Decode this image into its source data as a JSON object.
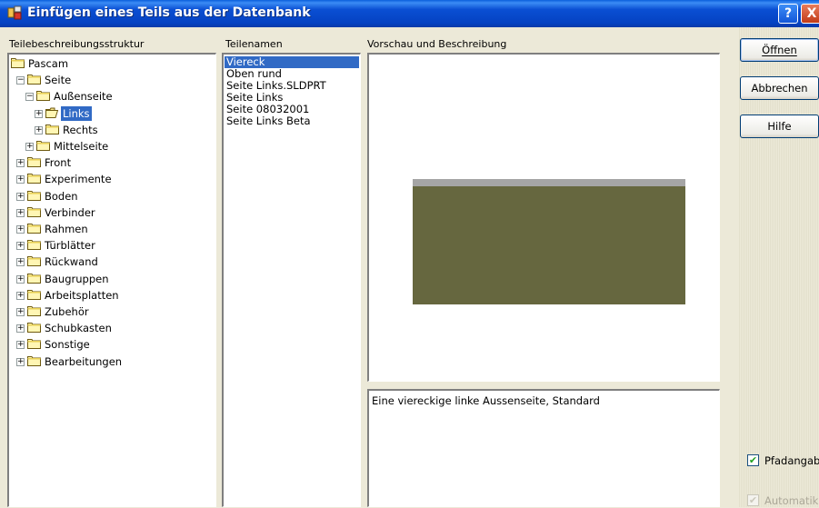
{
  "window": {
    "title": "Einfügen eines Teils aus der Datenbank",
    "help_label": "?",
    "close_label": "X"
  },
  "labels": {
    "tree": "Teilebeschreibungsstruktur",
    "parts": "Teilenamen",
    "preview": "Vorschau und Beschreibung"
  },
  "tree": {
    "items": [
      {
        "label": "Pascam",
        "expander": "",
        "selected": false
      },
      {
        "label": "Seite",
        "expander": "−",
        "selected": false
      },
      {
        "label": "Außenseite",
        "expander": "−",
        "selected": false
      },
      {
        "label": "Links",
        "expander": "+",
        "selected": true
      },
      {
        "label": "Rechts",
        "expander": "+",
        "selected": false
      },
      {
        "label": "Mittelseite",
        "expander": "+",
        "selected": false
      },
      {
        "label": "Front",
        "expander": "+",
        "selected": false
      },
      {
        "label": "Experimente",
        "expander": "+",
        "selected": false
      },
      {
        "label": "Boden",
        "expander": "+",
        "selected": false
      },
      {
        "label": "Verbinder",
        "expander": "+",
        "selected": false
      },
      {
        "label": "Rahmen",
        "expander": "+",
        "selected": false
      },
      {
        "label": "Türblätter",
        "expander": "+",
        "selected": false
      },
      {
        "label": "Rückwand",
        "expander": "+",
        "selected": false
      },
      {
        "label": "Baugruppen",
        "expander": "+",
        "selected": false
      },
      {
        "label": "Arbeitsplatten",
        "expander": "+",
        "selected": false
      },
      {
        "label": "Zubehör",
        "expander": "+",
        "selected": false
      },
      {
        "label": "Schubkasten",
        "expander": "+",
        "selected": false
      },
      {
        "label": "Sonstige",
        "expander": "+",
        "selected": false
      },
      {
        "label": "Bearbeitungen",
        "expander": "+",
        "selected": false
      }
    ]
  },
  "parts": {
    "items": [
      {
        "label": "Viereck",
        "selected": true
      },
      {
        "label": "Oben rund",
        "selected": false
      },
      {
        "label": "Seite Links.SLDPRT",
        "selected": false
      },
      {
        "label": "Seite Links",
        "selected": false
      },
      {
        "label": "Seite 08032001",
        "selected": false
      },
      {
        "label": "Seite Links Beta",
        "selected": false
      }
    ]
  },
  "preview": {
    "description": "Eine viereckige linke Aussenseite, Standard",
    "colors": {
      "top_strip": "#a5a5a5",
      "body": "#66673f"
    }
  },
  "buttons": {
    "open": "Öffnen",
    "cancel": "Abbrechen",
    "help": "Hilfe"
  },
  "options": {
    "path": {
      "label": "Pfadangabe",
      "checked": true,
      "enabled": true
    },
    "auto": {
      "label": "Automatik",
      "checked": true,
      "enabled": false
    }
  }
}
